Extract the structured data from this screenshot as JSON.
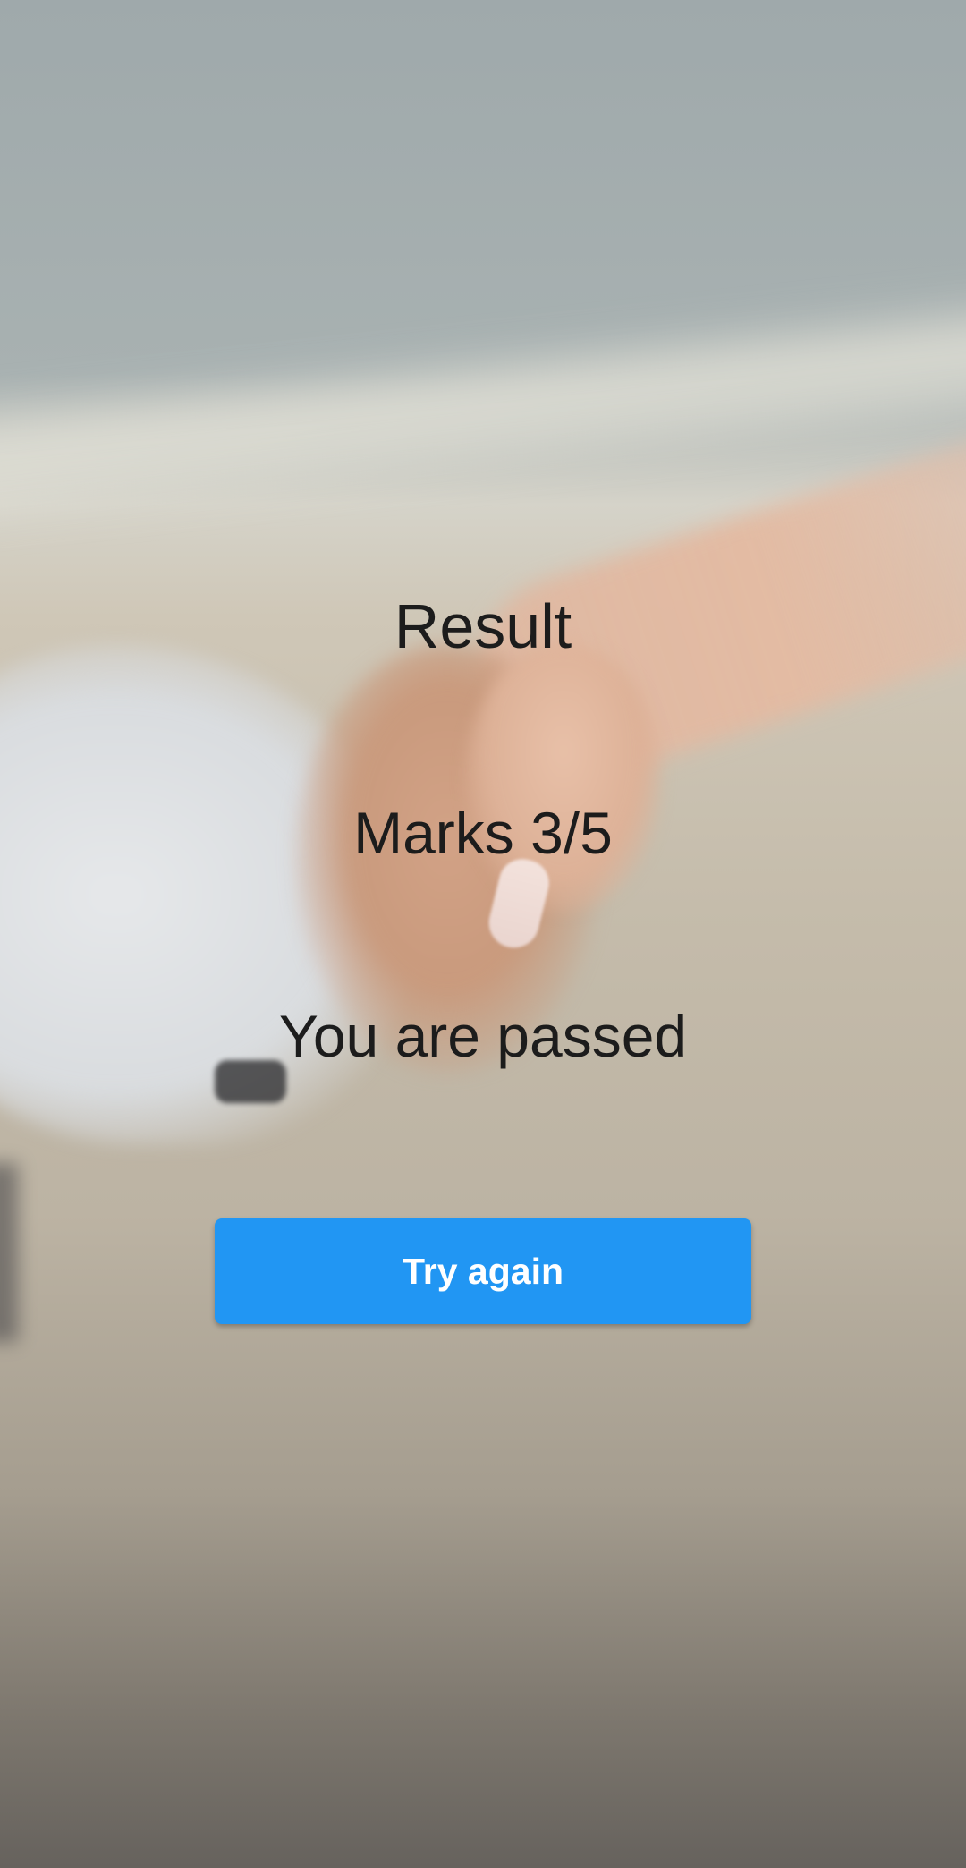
{
  "result": {
    "title": "Result",
    "marks": "Marks 3/5",
    "status": "You are passed",
    "try_again_label": "Try again"
  },
  "colors": {
    "button_background": "#2196f3",
    "button_text": "#ffffff",
    "text": "#1c1c1c"
  },
  "background": {
    "image_semantic": "handshake-photo"
  }
}
